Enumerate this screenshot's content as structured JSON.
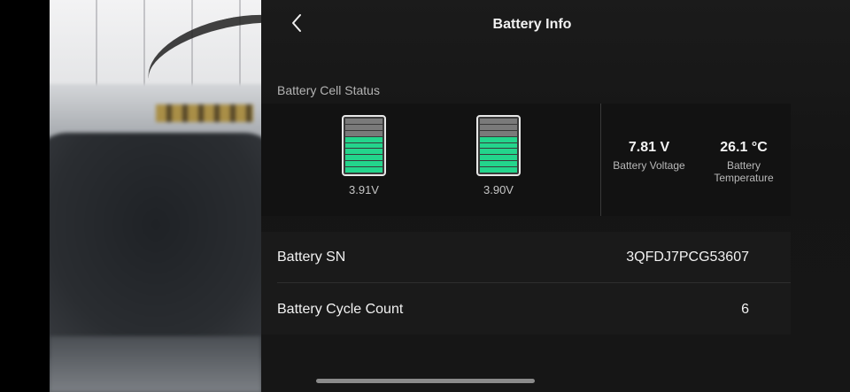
{
  "header": {
    "title": "Battery Info",
    "back_icon": "chevron-left-icon"
  },
  "cell_status": {
    "section_label": "Battery Cell Status",
    "cells": [
      {
        "voltage": "3.91V",
        "level_segments": 6,
        "total_segments": 9
      },
      {
        "voltage": "3.90V",
        "level_segments": 6,
        "total_segments": 9
      }
    ],
    "voltage": {
      "value": "7.81 V",
      "label": "Battery Voltage"
    },
    "temperature": {
      "value": "26.1 °C",
      "label": "Battery Temperature"
    }
  },
  "info": {
    "serial_label": "Battery SN",
    "serial_value": "3QFDJ7PCG53607",
    "cycle_label": "Battery Cycle Count",
    "cycle_value": "6"
  },
  "colors": {
    "charged_segment": "#23d58c",
    "empty_segment": "#7a7a7a",
    "panel_background": "#1b1b1b"
  }
}
